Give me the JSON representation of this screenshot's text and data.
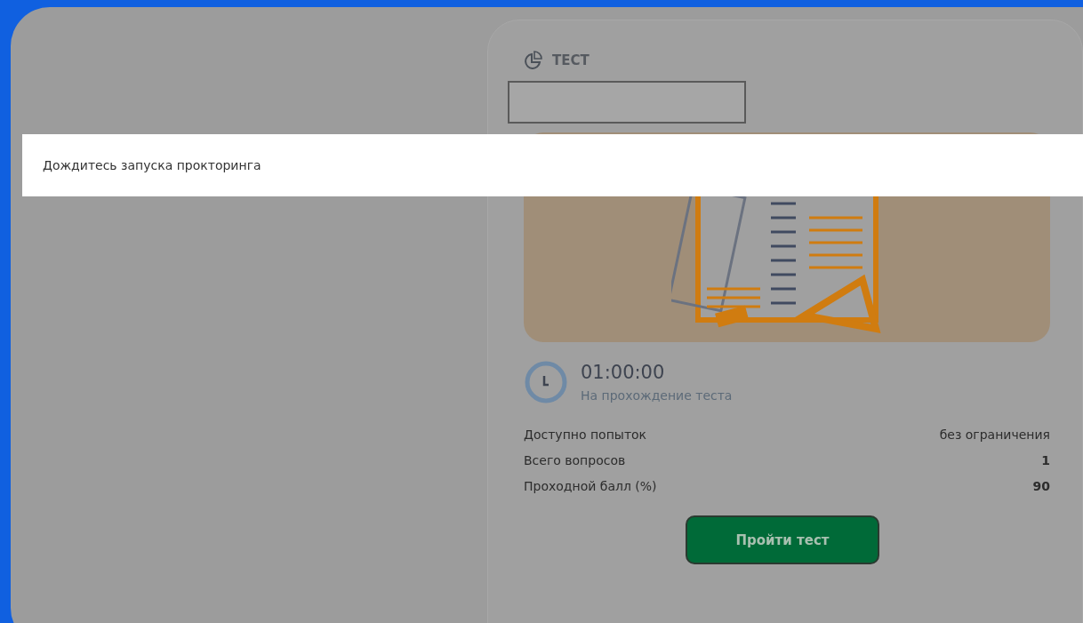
{
  "notice": {
    "text": "Дождитесь запуска прокторинга"
  },
  "card": {
    "title": "ТЕСТ",
    "timer": {
      "time": "01:00:00",
      "caption": "На прохождение теста"
    },
    "stats": [
      {
        "label": "Доступно попыток",
        "value": "без ограничения"
      },
      {
        "label": "Всего вопросов",
        "value": "1"
      },
      {
        "label": "Проходной балл (%)",
        "value": "90"
      }
    ],
    "button": "Пройти тест"
  }
}
